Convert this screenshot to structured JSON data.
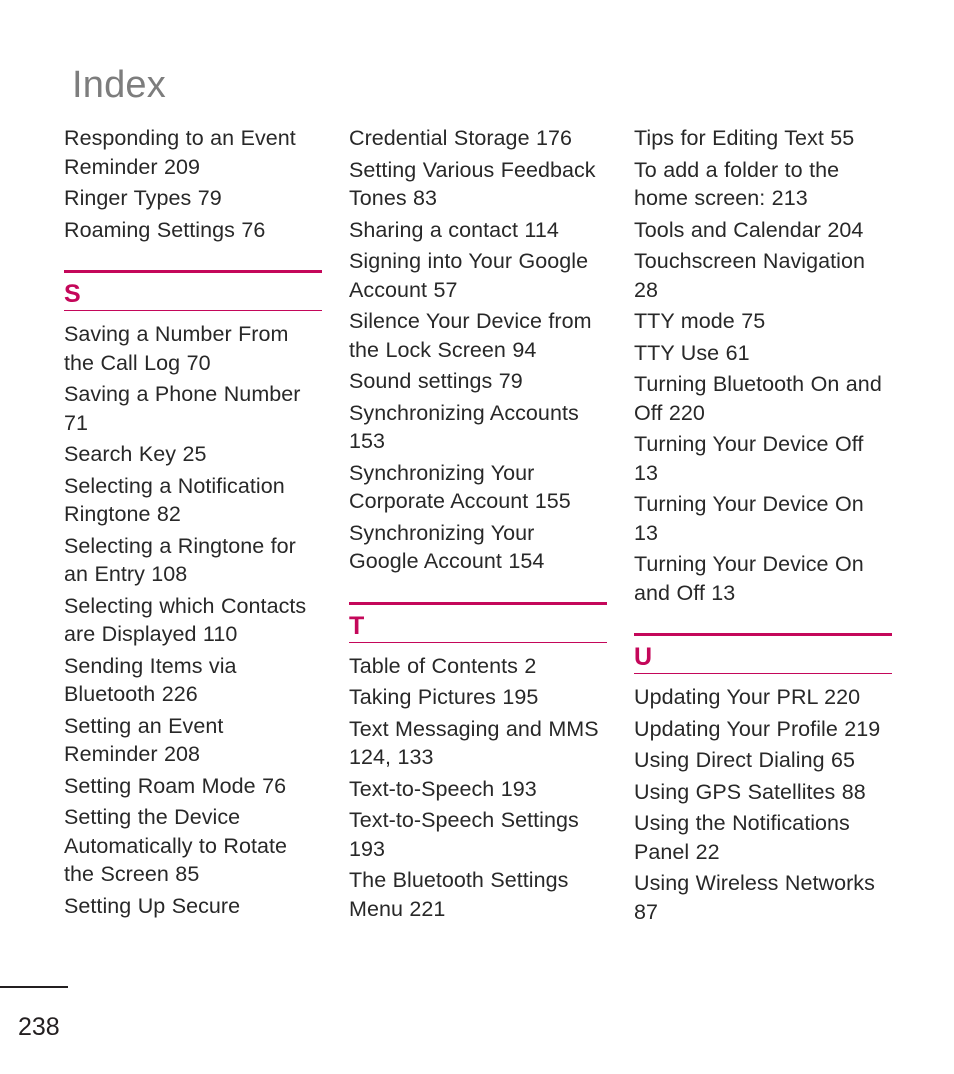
{
  "page": {
    "title": "Index",
    "number": "238",
    "accent_color": "#c4075a",
    "title_color": "#7d7d7d",
    "text_color": "#282828"
  },
  "columns": [
    {
      "name": "column-1",
      "blocks": [
        {
          "type": "entries",
          "items": [
            "Responding to an Event Reminder 209",
            "Ringer Types 79",
            "Roaming Settings 76"
          ]
        },
        {
          "type": "section",
          "letter": "S"
        },
        {
          "type": "entries",
          "items": [
            "Saving a Number From the Call Log 70",
            "Saving a Phone Number 71",
            "Search Key 25",
            "Selecting a Notification Ringtone 82",
            "Selecting a Ringtone for an Entry 108",
            "Selecting which Contacts are Displayed 110",
            "Sending Items via Bluetooth 226",
            "Setting an Event Reminder 208",
            "Setting Roam Mode 76",
            "Setting the Device Automatically to Rotate the Screen 85",
            "Setting Up Secure"
          ]
        }
      ]
    },
    {
      "name": "column-2",
      "blocks": [
        {
          "type": "entries",
          "items": [
            "Credential Storage 176",
            "Setting Various Feedback Tones 83",
            "Sharing a contact 114",
            "Signing into Your Google Account 57",
            "Silence Your Device from the Lock Screen 94",
            "Sound settings 79",
            "Synchronizing Accounts 153",
            "Synchronizing Your Corporate Account 155",
            "Synchronizing Your Google Account 154"
          ]
        },
        {
          "type": "section",
          "letter": "T"
        },
        {
          "type": "entries",
          "items": [
            "Table of Contents 2",
            "Taking Pictures 195",
            "Text Messaging and MMS 124, 133",
            "Text-to-Speech 193",
            "Text-to-Speech Settings 193",
            "The Bluetooth Settings Menu 221"
          ]
        }
      ]
    },
    {
      "name": "column-3",
      "blocks": [
        {
          "type": "entries",
          "items": [
            "Tips for Editing Text 55",
            "To add a folder to the home screen: 213",
            "Tools and Calendar 204",
            "Touchscreen Navigation 28",
            "TTY mode 75",
            "TTY Use 61",
            "Turning Bluetooth On and Off 220",
            "Turning Your Device Off 13",
            "Turning Your Device On 13",
            "Turning Your Device On and Off 13"
          ]
        },
        {
          "type": "section",
          "letter": "U"
        },
        {
          "type": "entries",
          "items": [
            "Updating Your PRL 220",
            "Updating Your Profile 219",
            "Using Direct Dialing 65",
            "Using GPS Satellites 88",
            "Using the Notifications Panel 22",
            "Using Wireless Networks 87"
          ]
        }
      ]
    }
  ]
}
